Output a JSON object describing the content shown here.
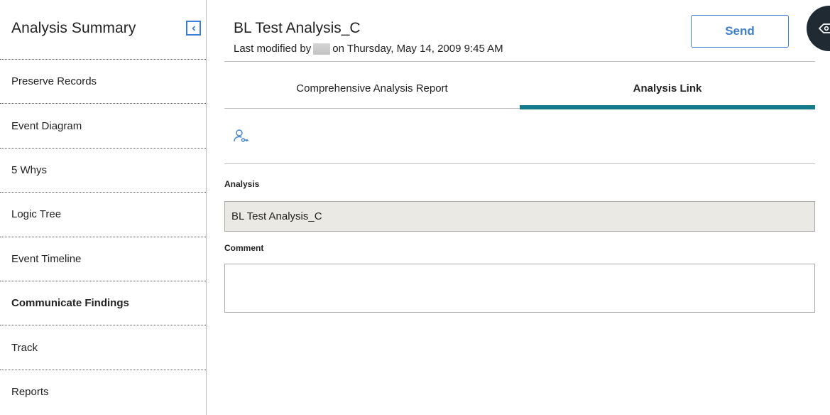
{
  "sidebar": {
    "title": "Analysis Summary",
    "items": [
      {
        "label": "Preserve Records"
      },
      {
        "label": "Event Diagram"
      },
      {
        "label": "5 Whys"
      },
      {
        "label": "Logic Tree"
      },
      {
        "label": "Event Timeline"
      },
      {
        "label": "Communicate Findings"
      },
      {
        "label": "Track"
      },
      {
        "label": "Reports"
      }
    ],
    "active_item": "Communicate Findings"
  },
  "header": {
    "title": "BL Test Analysis_C",
    "modified_prefix": "Last modified by",
    "modified_suffix": "on Thursday, May 14, 2009 9:45 AM",
    "send_label": "Send"
  },
  "tabs": [
    {
      "label": "Comprehensive Analysis Report"
    },
    {
      "label": "Analysis Link"
    }
  ],
  "active_tab": "Analysis Link",
  "form": {
    "analysis_label": "Analysis",
    "analysis_value": "BL Test Analysis_C",
    "comment_label": "Comment",
    "comment_value": ""
  },
  "icons": {
    "collapse": "chevron-left-icon",
    "toolbar": "user-key-icon",
    "fab": "eye-tag-icon"
  },
  "colors": {
    "accent": "#3d7fd4",
    "tab_indicator": "#157a8c",
    "readonly_bg": "#ebe9e3",
    "fab_bg": "#1f2a33"
  }
}
